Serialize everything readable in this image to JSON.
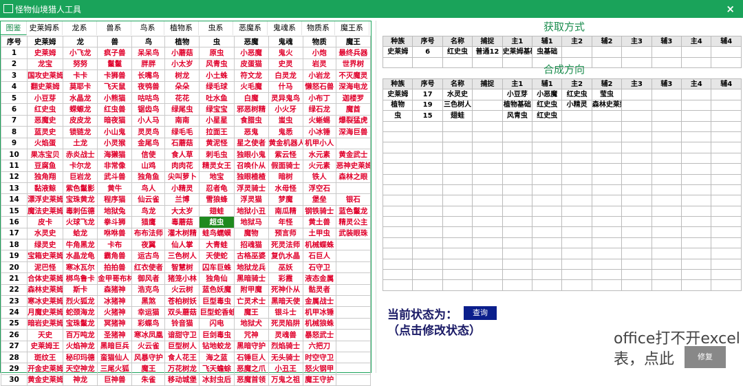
{
  "window": {
    "title": "怪物仙境猎人工具",
    "close": "×"
  },
  "tabs": [
    "图鉴",
    "史莱姆系",
    "龙系",
    "兽系",
    "鸟系",
    "植物系",
    "虫系",
    "恶魔系",
    "鬼魂系",
    "物质系",
    "魔王系"
  ],
  "grid": {
    "headers": [
      "序号",
      "史莱姆",
      "龙",
      "兽",
      "鸟",
      "植物",
      "虫",
      "恶魔",
      "鬼魂",
      "物质",
      "魔王"
    ],
    "rows": [
      [
        "1",
        "史莱姆",
        "小飞龙",
        "疯子兽",
        "呆呆鸟",
        "小蘑菇",
        "原虫",
        "小恶魔",
        "鬼火",
        "小炮",
        "最终兵器"
      ],
      [
        "2",
        "龙宝",
        "努努",
        "鬣鬣",
        "胖胖",
        "小太岁",
        "风青虫",
        "皮蛋猫",
        "史灵",
        "岩灵",
        "世界树"
      ],
      [
        "3",
        "国攻史莱姆",
        "卡卡",
        "卡狮兽",
        "长嘴鸟",
        "树龙",
        "小土蛛",
        "符文龙",
        "白灵龙",
        "小岩龙",
        "不灭魔灵"
      ],
      [
        "4",
        "翻史莱姆",
        "莫耶卡",
        "飞天鼠",
        "夜鸮兽",
        "朵朵",
        "绿毛球",
        "火毛魔",
        "什马",
        "懒怒石兽",
        "深海电龙"
      ],
      [
        "5",
        "小豆芽",
        "水晶龙",
        "小熊猫",
        "咕咕鸟",
        "花花",
        "吐水鱼",
        "白魔",
        "灵异鬼鸟",
        "小布丁",
        "迦楼罗"
      ],
      [
        "6",
        "红史虫",
        "蝾螈龙",
        "红虫兽",
        "锯齿鸟",
        "绿尾虫",
        "绿宝宝",
        "邪恶树精",
        "小火牙",
        "绿石龙",
        "魔酋"
      ],
      [
        "7",
        "恶魔史",
        "皮皮龙",
        "暗夜猫",
        "小人马",
        "南南",
        "小星星",
        "食腊虫",
        "蚩虫",
        "火蜥蜴",
        "爆裂猛虎"
      ],
      [
        "8",
        "蓝灵史",
        "锁链龙",
        "小山鬼",
        "灵灵鸟",
        "绿毛毛",
        "拉面王",
        "恶鬼",
        "鬼悉",
        "小冰锤",
        "深海巨兽"
      ],
      [
        "9",
        "火焰蛋",
        "土龙",
        "小灵猴",
        "金尾鸟",
        "石蘑菇",
        "黄泥怪",
        "星之使者",
        "黄金机器人",
        "机甲小人",
        ""
      ],
      [
        "10",
        "果冻宝贝",
        "赤炎战士",
        "海獭猫",
        "信使",
        "食人草",
        "刺毛虫",
        "独眼小鬼",
        "紫云怪",
        "水元素",
        "黄金武士"
      ],
      [
        "11",
        "豆腐鱼",
        "卡尔龙",
        "非常像",
        "山鸡",
        "肉肉花",
        "精灵女王",
        "召唤仆从",
        "假面骑士",
        "火元素",
        "恶神史莱姆"
      ],
      [
        "12",
        "独角翔",
        "巨岩龙",
        "武斗兽",
        "独角鱼",
        "尖叫萝卜",
        "地宝",
        "独眼楂楂",
        "暗树",
        "铁人",
        "森林之眼"
      ],
      [
        "13",
        "黏液鲸",
        "紫色鬣影",
        "黄牛",
        "鸟人",
        "小精灵",
        "忍者龟",
        "浮灵骑士",
        "水母怪",
        "浮空石",
        ""
      ],
      [
        "14",
        "漂浮史莱姆",
        "宝珠黄龙",
        "程序猫",
        "仙云雀",
        "兰博",
        "雪狼蜂",
        "浮灵猫",
        "梦魔",
        "堡垒",
        "银石"
      ],
      [
        "15",
        "魔法史莱姆",
        "毒刺伍德",
        "地狱兔",
        "鸟龙",
        "大太岁",
        "翅蛙",
        "地狱小丑",
        "南瓜精",
        "钢铁骑士",
        "蓝色鬣龙"
      ],
      [
        "16",
        "皮卡",
        "火球飞龙",
        "拳斗狮",
        "猎鹰",
        "毒蘑菇",
        "超虫",
        "地狱马",
        "年怪",
        "黄土兽",
        "精灵公主"
      ],
      [
        "17",
        "水灵史",
        "蛤龙",
        "咻咻兽",
        "布布法师",
        "灌木树精",
        "蛙鸟蠕蟆",
        "魔物",
        "预言师",
        "土甲虫",
        "武装眼珠"
      ],
      [
        "18",
        "绿灵史",
        "牛角黑龙",
        "卡布",
        "夜翼",
        "仙人掌",
        "大青蛙",
        "招魂猫",
        "死灵法师",
        "机械蝶蛛",
        ""
      ],
      [
        "19",
        "宝箱史莱姆",
        "水晶龙龟",
        "霸角兽",
        "运古鸟",
        "三色树人",
        "天使蛇",
        "古格巫婆",
        "复仇水晶",
        "石巨人",
        ""
      ],
      [
        "20",
        "泥巴怪",
        "寒冰瓦尔",
        "拍拍兽",
        "红衣使者",
        "智慧树",
        "囚车巨蛛",
        "地狱龙兵",
        "巫妖",
        "石守卫",
        ""
      ],
      [
        "21",
        "合体史莱姆",
        "梆鸟鲁卡",
        "金甲哥布林",
        "御风者",
        "猪笼小林",
        "独角仙",
        "黑暗骑士",
        "彩霞",
        "液态金属",
        ""
      ],
      [
        "22",
        "森林史莱姆",
        "斯卡",
        "森猪神",
        "浩克鸟",
        "火云树",
        "蓝色妖魔",
        "附甲魔",
        "死神仆从",
        "骷灵者",
        ""
      ],
      [
        "23",
        "寒冰史莱姆",
        "烈火狐龙",
        "冰猪神",
        "黑煞",
        "苍柏树妖",
        "巨型毒虫",
        "亡灵术士",
        "黑暗天使",
        "金属战士",
        ""
      ],
      [
        "24",
        "月魔史莱姆",
        "蛇颈海龙",
        "火猪神",
        "幸运猫",
        "双头蘑菇",
        "巨型蛇香蛙",
        "魔王",
        "银斗士",
        "机甲冰锤",
        ""
      ],
      [
        "25",
        "暗岩史莱姆",
        "宝珠鬣龙",
        "冥猪神",
        "彩蝶鸟",
        "铃音猫",
        "闪电",
        "地狱犬",
        "死灵陷阱",
        "机械狼蛛",
        ""
      ],
      [
        "26",
        "天史",
        "百万吨龙",
        "圣猪神",
        "寒冰凤凰",
        "谙甜守卫",
        "巨剑毒虫",
        "咒神",
        "灵魂兽",
        "暴怒武士",
        ""
      ],
      [
        "27",
        "史莱姆王",
        "火焰神龙",
        "黑暗巨兵",
        "火云雀",
        "巨型树人",
        "钻地蛟龙",
        "黑暗守护",
        "烈焰骑士",
        "六把刀",
        ""
      ],
      [
        "28",
        "斑纹王",
        "秘印玛德",
        "蛮猫仙人",
        "风暴守护",
        "食人花王",
        "海之蓝",
        "石锤巨人",
        "无头骑士",
        "时空守卫",
        ""
      ],
      [
        "29",
        "开金史莱姆",
        "天空神龙",
        "三尾火狐",
        "魔王",
        "万花树龙",
        "飞天蟾蜍",
        "恶魔之爪",
        "小丑王",
        "怒火钢甲",
        ""
      ],
      [
        "30",
        "黄金史莱姆",
        "神龙",
        "巨神兽",
        "朱雀",
        "移动城堡",
        "冰封虫后",
        "恶魔首领",
        "万鬼之祖",
        "魔王守护",
        ""
      ]
    ]
  },
  "acquire": {
    "title": "获取方式",
    "headers": [
      "种族",
      "序号",
      "名称",
      "捕捉",
      "主1",
      "辅1",
      "主2",
      "辅2",
      "主3",
      "辅3",
      "主4",
      "辅4"
    ],
    "rows": [
      [
        "史莱姆",
        "6",
        "红史虫",
        "普通12",
        "史莱姆基础",
        "虫基础",
        "",
        "",
        "",
        "",
        "",
        ""
      ]
    ]
  },
  "synth": {
    "title": "合成方向",
    "headers": [
      "种族",
      "序号",
      "名称",
      "捕捉",
      "主1",
      "辅1",
      "主2",
      "辅2",
      "主3",
      "辅3",
      "主4",
      "辅4"
    ],
    "rows": [
      [
        "史莱姆",
        "17",
        "水灵史",
        "",
        "小豆芽",
        "小恶魔",
        "红史虫",
        "莹虫",
        "",
        "",
        "",
        ""
      ],
      [
        "植物",
        "19",
        "三色树人",
        "",
        "植物基础",
        "红史虫",
        "小精灵",
        "森林史莱姆",
        "",
        "",
        "",
        ""
      ],
      [
        "虫",
        "15",
        "翅蛙",
        "",
        "风青虫",
        "红史虫",
        "",
        "",
        "",
        "",
        "",
        ""
      ]
    ]
  },
  "status": {
    "label": "当前状态为：",
    "button": "查询",
    "hint": "（点击修改状态）"
  },
  "watermark": {
    "line1": "office打不开excel",
    "line2": "表，点此",
    "button": "修复"
  }
}
